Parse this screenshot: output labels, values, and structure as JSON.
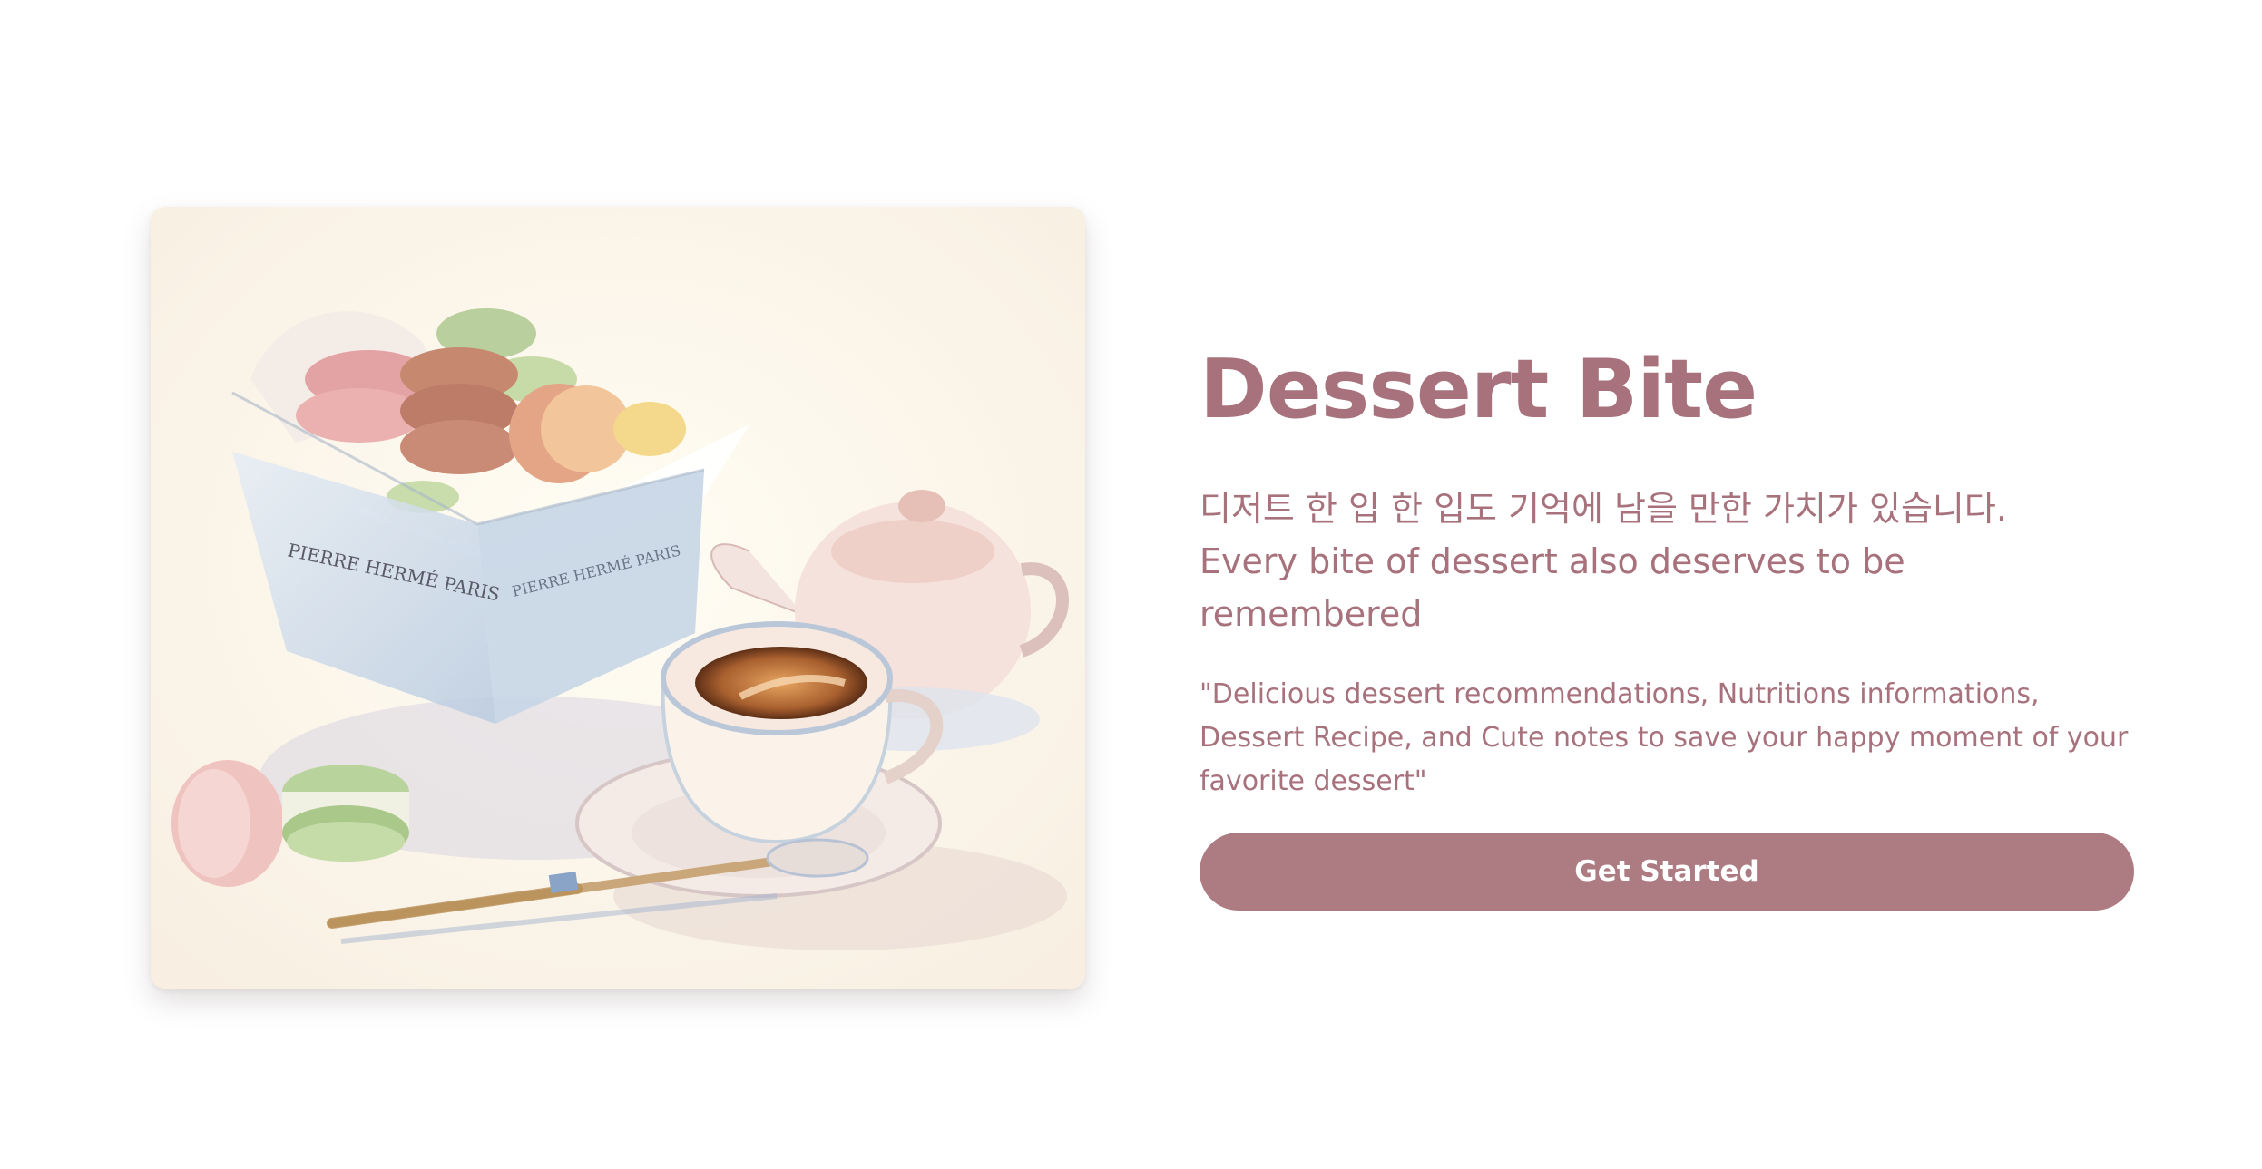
{
  "hero": {
    "image_label": "Watercolor illustration of a box of macarons, a cup of coffee with saucer and spoon, and a teapot",
    "box_text_left": "PIERRE HERMÉ PARIS",
    "box_text_right": "PIERRE HERMÉ PARIS"
  },
  "content": {
    "title": "Dessert Bite",
    "subtitle_ko": "디저트 한 입 한 입도 기억에 남을 만한 가치가 있습니다.",
    "subtitle_en": "Every bite of dessert also deserves to be remembered",
    "description": "\"Delicious dessert recommendations, Nutritions informations, Dessert Recipe, and Cute notes to save your happy moment of your favorite dessert\"",
    "cta_label": "Get Started"
  },
  "colors": {
    "accent": "#a8727d",
    "button": "#ad7b82",
    "button_text": "#ffffff",
    "background": "#ffffff"
  }
}
